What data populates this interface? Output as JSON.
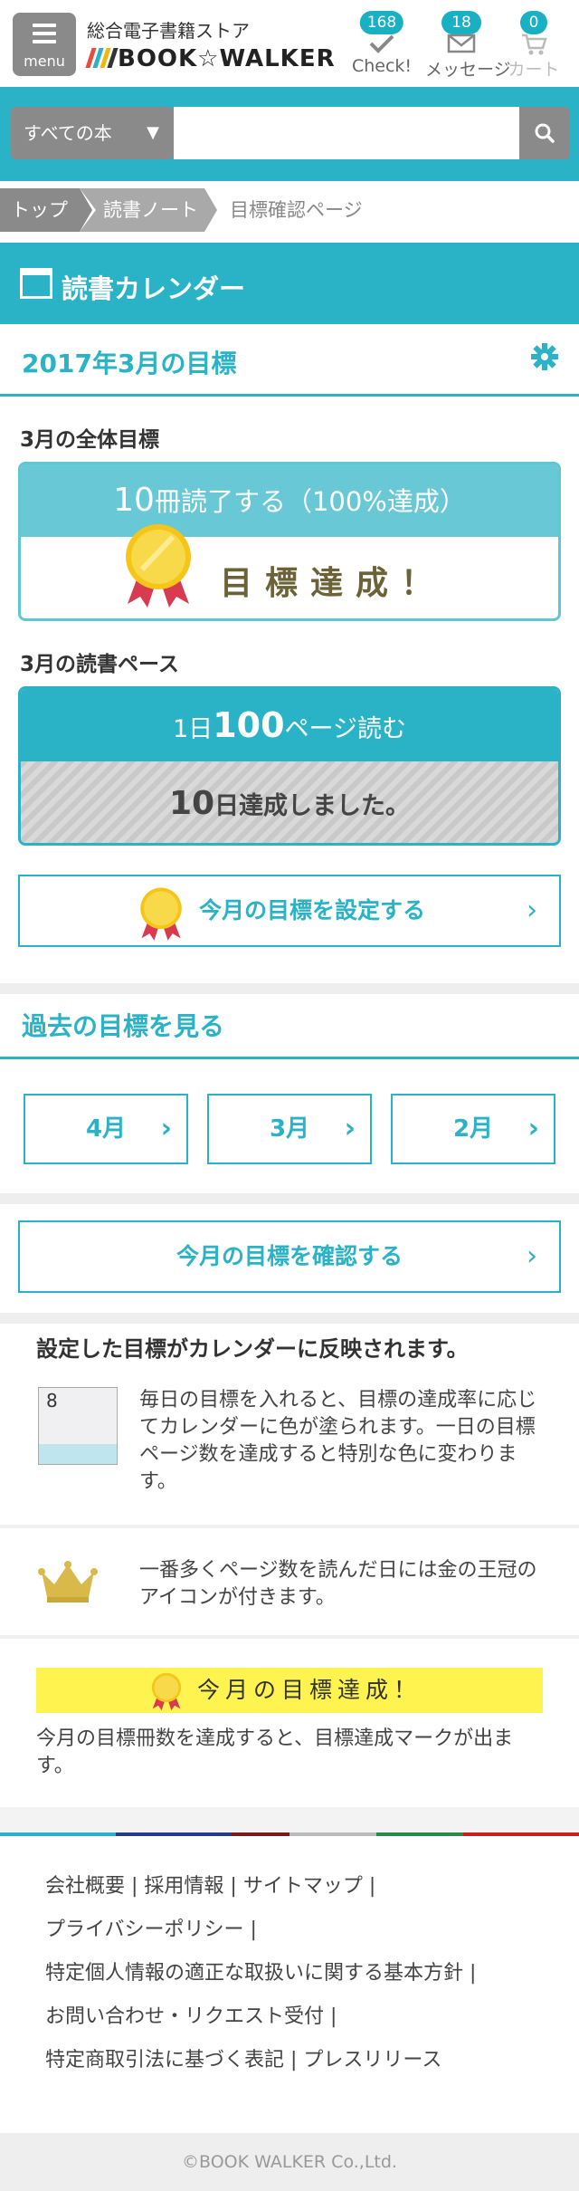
{
  "header": {
    "menu_label": "menu",
    "site_subtitle": "総合電子書籍ストア",
    "logo_text": "BOOK☆WALKER",
    "check": {
      "count": "168",
      "label": "Check!"
    },
    "message": {
      "count": "18",
      "label": "メッセージ"
    },
    "cart": {
      "count": "0",
      "label": "カート"
    }
  },
  "search": {
    "category": "すべての本",
    "placeholder": ""
  },
  "breadcrumb": {
    "items": [
      "トップ",
      "読書ノート"
    ],
    "current": "目標確認ページ"
  },
  "page": {
    "section_title": "読書カレンダー",
    "month_title": "2017年3月の目標",
    "overall_heading": "3月の全体目標",
    "overall_goal": {
      "count": "10",
      "text": "冊読了する（100%達成）",
      "status": "目標達成！"
    },
    "pace_heading": "3月の読書ペース",
    "pace": {
      "prefix": "1日",
      "pages": "100",
      "suffix": "ページ読む",
      "days": "10",
      "days_suffix": "日達成しました。"
    },
    "set_goal_button": "今月の目標を設定する",
    "past_title": "過去の目標を見る",
    "past_months": [
      "4月",
      "3月",
      "2月"
    ],
    "confirm_button": "今月の目標を確認する"
  },
  "info": {
    "title": "設定した目標がカレンダーに反映されます。",
    "calendar_day": "8",
    "calendar_text": "毎日の目標を入れると、目標の達成率に応じてカレンダーに色が塗られます。一日の目標ページ数を達成すると特別な色に変わります。",
    "crown_text": "一番多くページ数を読んだ日には金の王冠のアイコンが付きます。",
    "banner_text": "今月の目標達成！",
    "banner_desc": "今月の目標冊数を達成すると、目標達成マークが出ます。"
  },
  "footer": {
    "links": [
      "会社概要",
      "採用情報",
      "サイトマップ",
      "プライバシーポリシー",
      "特定個人情報の適正な取扱いに関する基本方針",
      "お問い合わせ・リクエスト受付",
      "特定商取引法に基づく表記",
      "プレスリリース"
    ],
    "copyright": "©BOOK WALKER Co.,Ltd."
  },
  "colors": {
    "accent": "#2ab3c6",
    "gold": "#f5c518",
    "banner": "#fff44f"
  }
}
